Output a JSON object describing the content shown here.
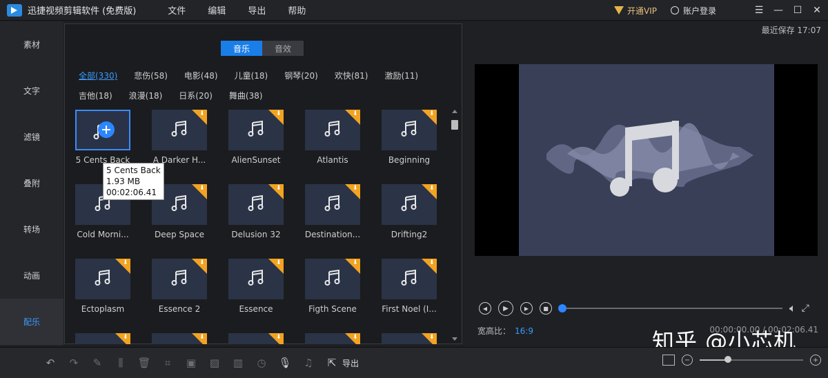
{
  "app": {
    "title": "迅捷视频剪辑软件 (免费版)"
  },
  "menu": [
    "文件",
    "编辑",
    "导出",
    "帮助"
  ],
  "titlebar": {
    "vip_label": "开通VIP",
    "login_label": "账户登录"
  },
  "sidebar": {
    "items": [
      "素材",
      "文字",
      "滤镜",
      "叠附",
      "转场",
      "动画",
      "配乐"
    ],
    "active_index": 6
  },
  "library": {
    "tabs": [
      "音乐",
      "音效"
    ],
    "active_tab": 0,
    "categories": [
      "全部(330)",
      "悲伤(58)",
      "电影(48)",
      "儿童(18)",
      "钢琴(20)",
      "欢快(81)",
      "激励(11)",
      "吉他(18)",
      "浪漫(18)",
      "日系(20)",
      "舞曲(38)"
    ],
    "active_category": 0,
    "items": [
      {
        "name": "5 Cents Back",
        "selected": true,
        "download": false
      },
      {
        "name": "A Darker H...",
        "download": true
      },
      {
        "name": "AlienSunset",
        "download": true
      },
      {
        "name": "Atlantis",
        "download": true
      },
      {
        "name": "Beginning",
        "download": true
      },
      {
        "name": "Cold Morni...",
        "download": true
      },
      {
        "name": "Deep Space",
        "download": true
      },
      {
        "name": "Delusion 32",
        "download": true
      },
      {
        "name": "Destination...",
        "download": true
      },
      {
        "name": "Drifting2",
        "download": true
      },
      {
        "name": "Ectoplasm",
        "download": true
      },
      {
        "name": "Essence 2",
        "download": true
      },
      {
        "name": "Essence",
        "download": true
      },
      {
        "name": "Figth Scene",
        "download": true
      },
      {
        "name": "First Noel (I...",
        "download": true
      },
      {
        "name": "",
        "download": true
      },
      {
        "name": "",
        "download": true
      },
      {
        "name": "",
        "download": true
      },
      {
        "name": "",
        "download": true
      },
      {
        "name": "",
        "download": true
      }
    ],
    "tooltip": {
      "name": "5 Cents Back",
      "size": "1.93 MB",
      "duration": "00:02:06.41"
    }
  },
  "preview": {
    "autosave": "最近保存 17:07",
    "ratio_label": "宽高比：",
    "ratio_value": "16:9",
    "timecode": "00:00:00.00 / 00:02:06.41",
    "progress": 0.0
  },
  "watermark": "知乎 @小芯机",
  "toolbar": {
    "export_label": "导出",
    "zoom_level": 0.27
  },
  "colors": {
    "accent": "#1a7ee8",
    "download_badge": "#f2a321",
    "thumb_bg": "#2b3346"
  }
}
